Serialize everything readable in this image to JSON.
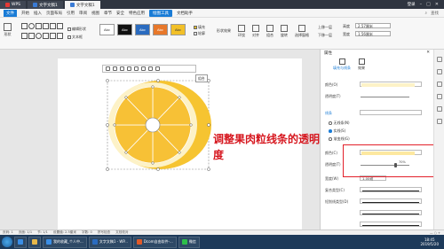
{
  "titlebar": {
    "tabs": [
      {
        "label": "WPS",
        "icon": "wps-icon"
      },
      {
        "label": "文字文稿1",
        "icon": "doc-icon"
      },
      {
        "label": "文字文稿1",
        "icon": "doc-icon"
      }
    ],
    "user": "登录"
  },
  "menubar": {
    "file": "文件",
    "items": [
      "开始",
      "插入",
      "页面布局",
      "引用",
      "审阅",
      "视图",
      "章节",
      "安全",
      "特色应用",
      "绘图工具",
      "文档助手"
    ],
    "active_index": 9,
    "search": "查找"
  },
  "ribbon": {
    "shape_btn": "形状",
    "edit_shape": "编辑形状",
    "textbox": "文本框",
    "styles": [
      "Abc",
      "Abc",
      "Abc",
      "Abc",
      "Abc"
    ],
    "fill": "填充",
    "outline": "轮廓",
    "shape_effect": "形状效果",
    "wrap": "环绕",
    "align": "对齐",
    "group": "组合",
    "rotate": "旋转",
    "select_pane": "选择窗格",
    "up_layer": "上移一层",
    "down_layer": "下移一层",
    "height_label": "高度",
    "height_value": "2.57厘米",
    "width_label": "宽度",
    "width_value": "1.56厘米"
  },
  "document": {
    "tooltip": "组合",
    "annotation": "调整果肉粒线条的透明度"
  },
  "panel": {
    "title": "属性",
    "tabs": [
      "填充与线条",
      "效果"
    ],
    "color_label": "颜色(O)",
    "transparency_label": "透明度(T)",
    "line_section": "线条",
    "no_line": "无线条(N)",
    "solid_line": "实线(S)",
    "gradient_line": "渐变线(G)",
    "line_color_label": "颜色(C)",
    "line_transparency_label": "透明度(T)",
    "line_transparency_value": "70%",
    "width_label": "宽度(W)",
    "width_value": "1.00磅",
    "compound_label": "复合类型(C)",
    "dash_label": "短划线类型(D)"
  },
  "statusbar": {
    "page": "页码: 1",
    "pages": "页面: 1/1",
    "section": "节: 1/1",
    "row": "设置值: 2.5厘米",
    "words": "字数: 0",
    "spell": "拼写检查",
    "doc_check": "文档校对"
  },
  "taskbar": {
    "items": [
      "我的收藏_个人中...",
      "文字文稿1 - WP...",
      "Dcom自由软件-...",
      "微信"
    ],
    "time": "18:45",
    "date": "2019/5/20"
  }
}
